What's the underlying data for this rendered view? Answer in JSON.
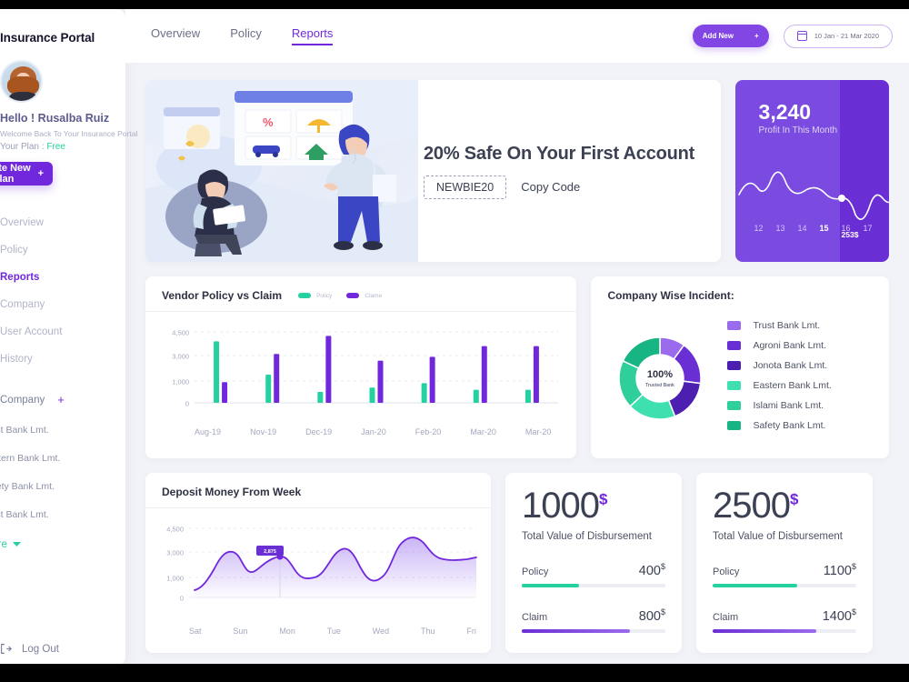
{
  "sidebar": {
    "brand": "Insurance Portal",
    "greeting": "Hello ! Rusalba Ruiz",
    "welcome": "Welcome Back To Your Insurance Portal",
    "plan_label": "Your Plan :",
    "plan_value": "Free",
    "create_plan_label": "Create New Plan",
    "create_plan_plus": "+",
    "nav": [
      {
        "label": "Overview",
        "active": false
      },
      {
        "label": "Policy",
        "active": false
      },
      {
        "label": "Reports",
        "active": true
      },
      {
        "label": "Company",
        "active": false
      },
      {
        "label": "User Account",
        "active": false
      },
      {
        "label": "History",
        "active": false
      }
    ],
    "company_header": "Company",
    "company_add": "+",
    "banks": [
      {
        "name": "Trust Bank Lmt."
      },
      {
        "name": "Eastern Bank Lmt."
      },
      {
        "name": "Safety Bank Lmt."
      },
      {
        "name": "Trust Bank Lmt."
      }
    ],
    "see_more": "See More",
    "logout": "Log Out"
  },
  "topbar": {
    "tabs": [
      {
        "label": "Overview",
        "active": false
      },
      {
        "label": "Policy",
        "active": false
      },
      {
        "label": "Reports",
        "active": true
      }
    ],
    "add_new_label": "Add New",
    "add_new_plus": "+",
    "date_range": "10 Jan - 21 Mar 2020"
  },
  "banner": {
    "title": "20% Safe On Your First Account",
    "promo_code": "NEWBIE20",
    "copy_label": "Copy Code"
  },
  "profit": {
    "value": "3,240",
    "label": "Profit In This Month",
    "point_label": "253$",
    "axis": [
      "12",
      "13",
      "14",
      "15",
      "16",
      "17"
    ],
    "highlight_index": 3
  },
  "chart_data": [
    {
      "type": "bar",
      "title": "Vendor Policy vs Claim",
      "categories": [
        "Aug-19",
        "Nov-19",
        "Dec-19",
        "Jan-20",
        "Feb-20",
        "Mar-20",
        "Mar-20"
      ],
      "series": [
        {
          "name": "Policy",
          "color": "#25d1a0",
          "values": [
            3900,
            1500,
            500,
            700,
            900,
            600,
            600
          ]
        },
        {
          "name": "Clame",
          "color": "#7128dd",
          "values": [
            950,
            3100,
            4250,
            2600,
            2900,
            3600,
            3600
          ]
        }
      ],
      "ylabel": "",
      "xlabel": "",
      "yticks": [
        0,
        1000,
        3000,
        4500
      ],
      "ytick_labels": [
        "0",
        "1,000",
        "3,000",
        "4,500"
      ],
      "ylim": [
        0,
        4500
      ],
      "grid": true,
      "legend": "top"
    },
    {
      "type": "pie",
      "title": "Company Wise Incident:",
      "center_value": "100%",
      "center_label": "Trusted Bank",
      "labels": [
        "Trust Bank Lmt.",
        "Agroni Bank Lmt.",
        "Jonota Bank Lmt.",
        "Eastern Bank Lmt.",
        "Islami Bank Lmt.",
        "Safety Bank Lmt."
      ],
      "values": [
        10,
        17,
        17,
        19,
        19,
        18
      ],
      "colors": [
        "#9a6bec",
        "#6a2fd4",
        "#4c1fb0",
        "#3fe0b0",
        "#2ecf9a",
        "#16b583"
      ],
      "legend": "right"
    },
    {
      "type": "area",
      "title": "Deposit Money From Week",
      "categories": [
        "Sat",
        "Sun",
        "Mon",
        "Tue",
        "Wed",
        "Thu",
        "Fri"
      ],
      "tooltip_value": "2,875",
      "yticks": [
        0,
        1000,
        3000,
        4500
      ],
      "ytick_labels": [
        "0",
        "1,000",
        "3,000",
        "4,500"
      ],
      "ylim": [
        0,
        4500
      ],
      "color": "#7128dd",
      "grid": true,
      "legend": "none"
    }
  ],
  "stats": [
    {
      "value": "1000",
      "currency": "$",
      "subtitle": "Total Value of Disbursement",
      "metrics": [
        {
          "name": "Policy",
          "value": "400",
          "currency": "$",
          "percent": 40,
          "color": "green"
        },
        {
          "name": "Claim",
          "value": "800",
          "currency": "$",
          "percent": 75,
          "color": "purple"
        }
      ]
    },
    {
      "value": "2500",
      "currency": "$",
      "subtitle": "Total Value of Disbursement",
      "metrics": [
        {
          "name": "Policy",
          "value": "1100",
          "currency": "$",
          "percent": 59,
          "color": "green"
        },
        {
          "name": "Claim",
          "value": "1400",
          "currency": "$",
          "percent": 72,
          "color": "purple"
        }
      ]
    }
  ]
}
